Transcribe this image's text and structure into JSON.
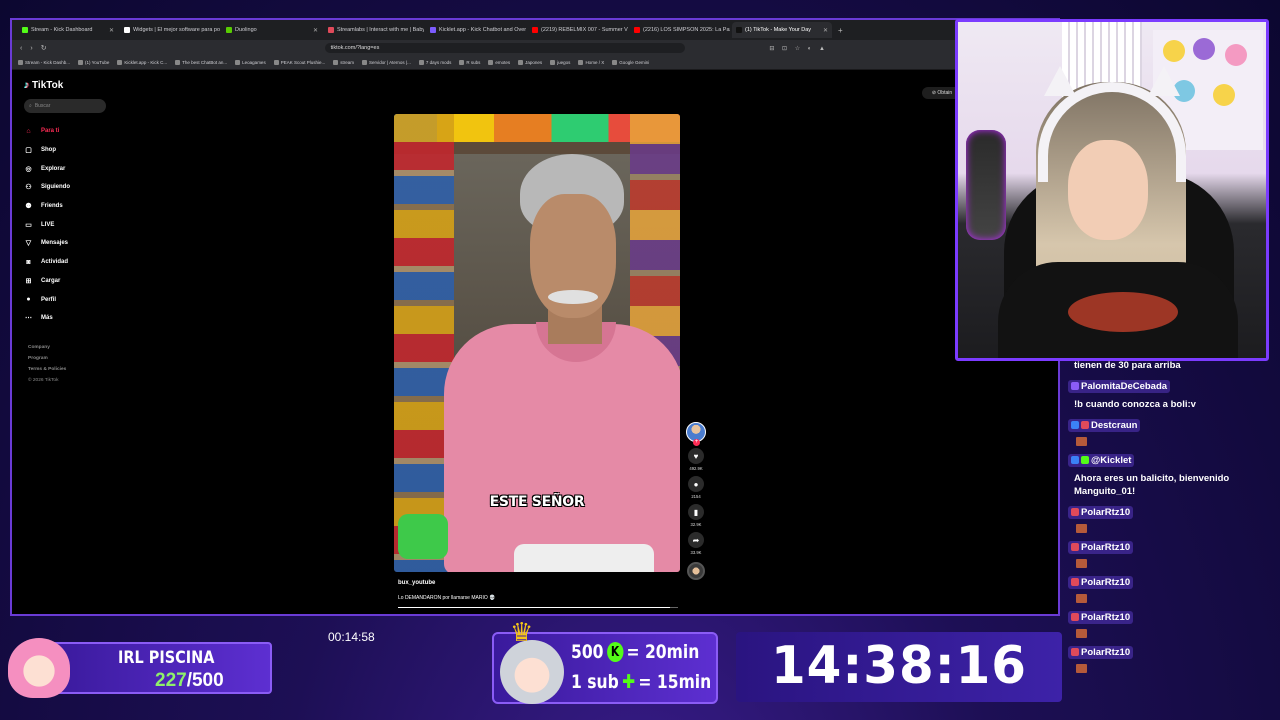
{
  "browser": {
    "tabs": [
      {
        "label": "Stream - Kick Dashboard",
        "color": "#53fc18",
        "active": false
      },
      {
        "label": "Widgets | El mejor software para po",
        "color": "#ffffff",
        "active": false
      },
      {
        "label": "Duolingo",
        "color": "#58cc02",
        "active": false
      },
      {
        "label": "Streamlabs | Interact with me | Baby",
        "color": "#e04a5a",
        "active": false
      },
      {
        "label": "Kicklet.app - Kick Chatbot and Overl",
        "color": "#7c5cff",
        "active": false
      },
      {
        "label": "(2219) REBELMIX 007 - Summer Vib",
        "color": "#ff0000",
        "active": false
      },
      {
        "label": "(2216) LOS SIMPSON 2025: La Pasión",
        "color": "#ff0000",
        "active": false
      },
      {
        "label": "(1) TikTok - Make Your Day",
        "color": "#111111",
        "active": true
      }
    ],
    "new_tab_label": "+",
    "url": "tiktok.com/?lang=es",
    "bookmarks": [
      "Stream - Kick Dashb...",
      "(1) YouTube",
      "Kicklet.app - Kick C...",
      "The best ChatBot an...",
      "Leoagames",
      "PEAK Scout Plushie...",
      "stream",
      "Servidor | Aternos |...",
      "7 days mods",
      "R subs",
      "emotes",
      "Japones",
      "juegos",
      "Home / X",
      "Google Gemini"
    ]
  },
  "tiktok": {
    "logo": "TikTok",
    "search_placeholder": "Buscar",
    "nav": [
      {
        "label": "Para ti",
        "icon": "home-icon",
        "glyph": "⌂",
        "active": true
      },
      {
        "label": "Shop",
        "icon": "shop-bag-icon",
        "glyph": "▢",
        "active": false
      },
      {
        "label": "Explorar",
        "icon": "compass-icon",
        "glyph": "◎",
        "active": false
      },
      {
        "label": "Siguiendo",
        "icon": "following-icon",
        "glyph": "⚇",
        "active": false
      },
      {
        "label": "Friends",
        "icon": "friends-icon",
        "glyph": "⚉",
        "active": false
      },
      {
        "label": "LIVE",
        "icon": "live-icon",
        "glyph": "▭",
        "active": false
      },
      {
        "label": "Mensajes",
        "icon": "messages-icon",
        "glyph": "▽",
        "active": false
      },
      {
        "label": "Actividad",
        "icon": "activity-icon",
        "glyph": "◙",
        "active": false
      },
      {
        "label": "Cargar",
        "icon": "upload-icon",
        "glyph": "⊞",
        "active": false
      },
      {
        "label": "Perfil",
        "icon": "profile-icon",
        "glyph": "●",
        "active": false
      },
      {
        "label": "Más",
        "icon": "more-icon",
        "glyph": "⋯",
        "active": false
      }
    ],
    "footer": [
      "Company",
      "Program",
      "Terms & Policies"
    ],
    "copyright": "© 2026 TikTok",
    "obtain_label": "Obtain",
    "video": {
      "caption": "ESTE SEÑOR",
      "author": "bux_youtube",
      "description": "Lo DEMANDARON por llamarse MARIO 💀",
      "progress": 0.97
    },
    "actions": {
      "likes": "492.9K",
      "comments": "2154",
      "saves": "32.9K",
      "shares": "33.9K"
    }
  },
  "chat": {
    "partial_top": "tienen de 30 para arriba",
    "messages": [
      {
        "user": "PalomitaDeCebada",
        "badges": [
          "#8b5cf6"
        ],
        "text": "!b cuando conozca a boli:v",
        "emote": false
      },
      {
        "user": "Destcraun",
        "badges": [
          "#3b82f6",
          "#e04a5a"
        ],
        "text": "",
        "emote": true
      },
      {
        "user": "@Kicklet",
        "badges": [
          "#3b82f6",
          "#53fc18"
        ],
        "text": "Ahora eres un balicito, bienvenido Manguito_01!",
        "emote": false
      },
      {
        "user": "PolarRtz10",
        "badges": [
          "#e04a5a"
        ],
        "text": "",
        "emote": true
      },
      {
        "user": "PolarRtz10",
        "badges": [
          "#e04a5a"
        ],
        "text": "",
        "emote": true
      },
      {
        "user": "PolarRtz10",
        "badges": [
          "#e04a5a"
        ],
        "text": "",
        "emote": true
      },
      {
        "user": "PolarRtz10",
        "badges": [
          "#e04a5a"
        ],
        "text": "",
        "emote": true
      },
      {
        "user": "PolarRtz10",
        "badges": [
          "#e04a5a"
        ],
        "text": "",
        "emote": true
      }
    ]
  },
  "overlay": {
    "goal_title": "IRL PISCINA",
    "goal_current": "227",
    "goal_total": "/500",
    "elapsed": "00:14:58",
    "sub_rule_1_amount": "500",
    "sub_rule_1_coin": "K",
    "sub_rule_1_time": "= 20min",
    "sub_rule_2_amount": "1 sub",
    "sub_rule_2_time": "= 15min",
    "countdown": "14:38:16"
  },
  "colors": {
    "accent": "#7b3bff",
    "kick_green": "#53fc18",
    "tiktok_red": "#fe2c55"
  }
}
